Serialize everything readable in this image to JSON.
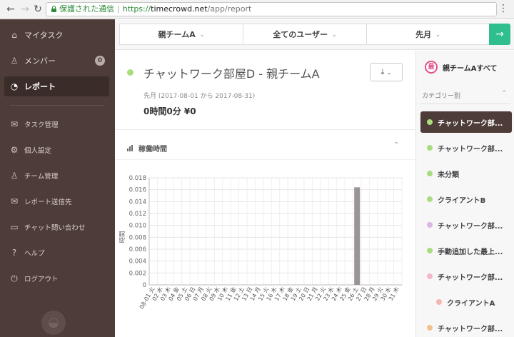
{
  "browser": {
    "secure_label": "保護された通信",
    "url_proto": "https://",
    "url_host": "timecrowd.net",
    "url_path": "/app/report"
  },
  "sidebar": {
    "items": [
      {
        "label": "マイタスク",
        "icon": "home-icon"
      },
      {
        "label": "メンバー",
        "icon": "person-icon",
        "badge": "0"
      },
      {
        "label": "レポート",
        "icon": "report-icon",
        "active": true
      },
      {
        "label": "タスク管理",
        "icon": "inbox-icon"
      },
      {
        "label": "個人設定",
        "icon": "gear-icon"
      },
      {
        "label": "チーム管理",
        "icon": "team-icon"
      },
      {
        "label": "レポート送信先",
        "icon": "mail-icon"
      },
      {
        "label": "チャット問い合わせ",
        "icon": "chat-icon"
      },
      {
        "label": "ヘルプ",
        "icon": "help-icon"
      },
      {
        "label": "ログアウト",
        "icon": "power-icon"
      }
    ]
  },
  "filters": {
    "team": "親チームA",
    "users": "全てのユーザー",
    "period": "先月"
  },
  "report": {
    "title": "チャットワーク部屋D - 親チームA",
    "status_color": "#a9dc7e",
    "period_label": "先月",
    "period_range": "(2017-08-01 から 2017-08-31)",
    "totals": "0時間0分 ¥0",
    "section_title": "稼働時間"
  },
  "chart_data": {
    "type": "bar",
    "ylabel": "時間",
    "ylim": [
      0,
      0.018
    ],
    "yticks": [
      0,
      0.002,
      0.004,
      0.006,
      0.008,
      0.01,
      0.012,
      0.014,
      0.016,
      0.018
    ],
    "ytick_labels": [
      "0",
      "0.002",
      "0.004",
      "0.006",
      "0.008",
      "0.010",
      "0.012",
      "0.014",
      "0.016",
      "0.018"
    ],
    "categories": [
      "08-01 火",
      "02 水",
      "03 木",
      "04 金",
      "05 土",
      "06 日",
      "07 月",
      "08 火",
      "09 水",
      "10 木",
      "11 金",
      "12 土",
      "13 日",
      "14 月",
      "15 火",
      "16 水",
      "17 木",
      "18 金",
      "19 土",
      "20 日",
      "21 月",
      "22 火",
      "23 水",
      "24 木",
      "25 金",
      "26 土",
      "27 日",
      "28 月",
      "29 火",
      "30 水",
      "31 木"
    ],
    "values": [
      0,
      0,
      0,
      0,
      0,
      0,
      0,
      0,
      0,
      0,
      0,
      0,
      0,
      0,
      0,
      0,
      0,
      0,
      0,
      0,
      0,
      0,
      0,
      0,
      0,
      0.0164,
      0,
      0,
      0,
      0,
      0
    ],
    "bar_color": "#9b9495",
    "grid": true
  },
  "right_panel": {
    "header": "親チームAすべて",
    "header_icon_text": "最",
    "category_label": "カテゴリー別",
    "categories": [
      {
        "label": "チャットワーク部...",
        "color": "#a9dc7e",
        "active": true
      },
      {
        "label": "チャットワーク部...",
        "color": "#a9dc7e"
      },
      {
        "label": "未分類",
        "color": "#a9dc7e"
      },
      {
        "label": "クライアントB",
        "color": "#a9dc7e"
      },
      {
        "label": "チャットワーク部...",
        "color": "#d9b8e2"
      },
      {
        "label": "手動追加した最上...",
        "color": "#a9dc7e"
      },
      {
        "label": "チャットワーク部...",
        "color": "#f3b8c8"
      },
      {
        "label": "クライアントA",
        "color": "#f3b8b0",
        "sub": true
      },
      {
        "label": "チャットワーク部...",
        "color": "#f6c08e"
      }
    ]
  }
}
